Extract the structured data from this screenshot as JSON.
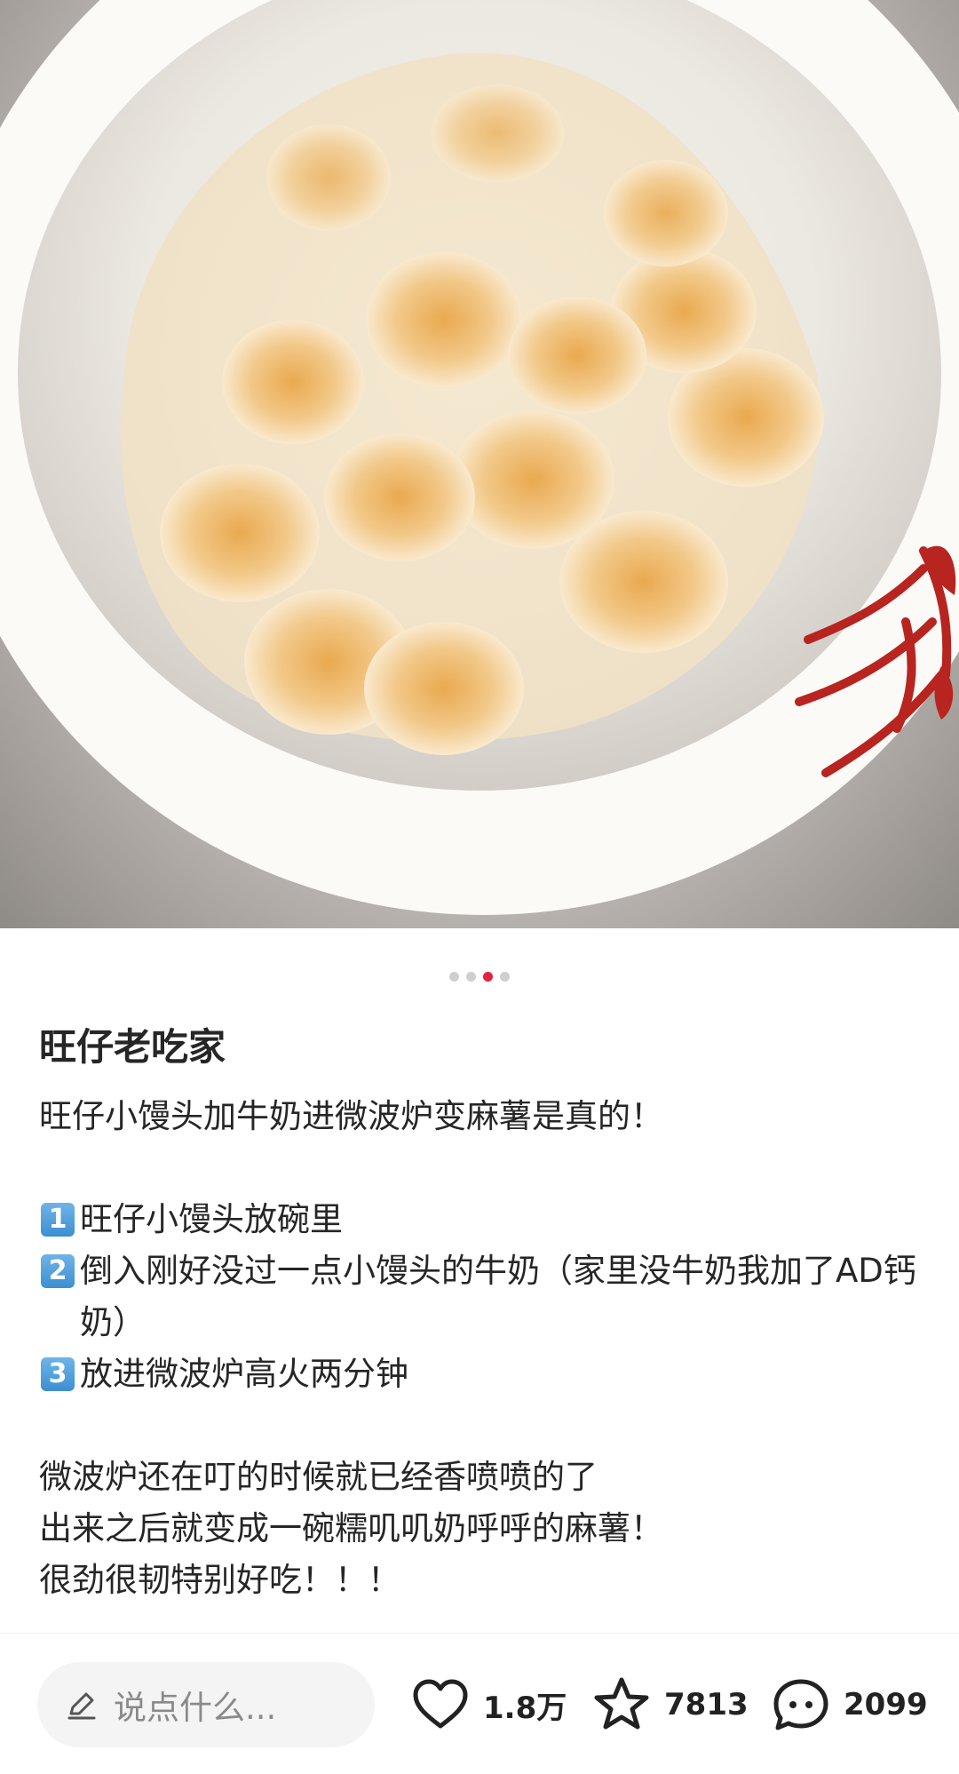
{
  "post": {
    "author_title": "旺仔老吃家",
    "intro": "旺仔小馒头加牛奶进微波炉变麻薯是真的！",
    "steps": [
      {
        "num": "1",
        "text": "旺仔小馒头放碗里"
      },
      {
        "num": "2",
        "text": "倒入刚好没过一点小馒头的牛奶（家里没牛奶我加了AD钙奶）"
      },
      {
        "num": "3",
        "text": "放进微波炉高火两分钟"
      }
    ],
    "outro": [
      "微波炉还在叮的时候就已经香喷喷的了",
      "出来之后就变成一碗糯叽叽奶呼呼的麻薯！",
      "很劲很韧特别好吃！！！"
    ]
  },
  "carousel": {
    "total": 4,
    "active_index": 3
  },
  "bottom_bar": {
    "comment_placeholder": "说点什么...",
    "likes": "1.8万",
    "collects": "7813",
    "comments": "2099"
  },
  "icons": {
    "comment_input": "pencil-icon",
    "like": "heart-icon",
    "collect": "star-icon",
    "comment": "chat-bubble-icon"
  },
  "colors": {
    "active_dot": "#e3233f",
    "step_badge": "#4a9bdb",
    "bowl_flower": "#b8241f"
  }
}
